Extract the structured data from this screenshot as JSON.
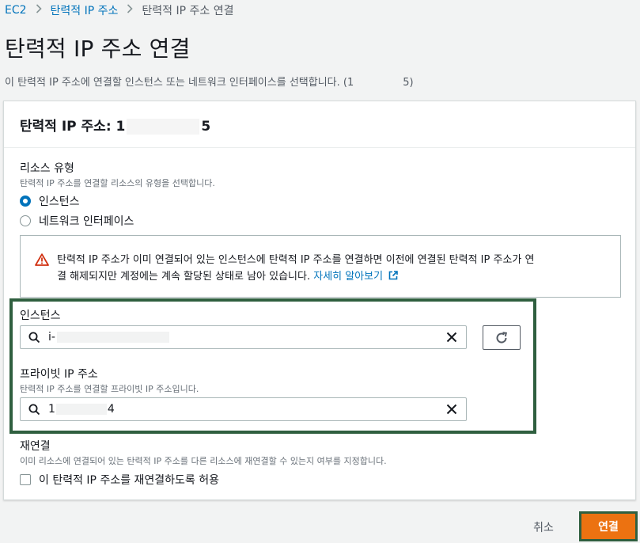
{
  "breadcrumb": {
    "items": [
      "EC2",
      "탄력적 IP 주소",
      "탄력적 IP 주소 연결"
    ]
  },
  "page": {
    "title": "탄력적 IP 주소 연결",
    "description_prefix": "이 탄력적 IP 주소에 연결할 인스턴스 또는 네트워크 인터페이스를 선택합니다. (1",
    "description_suffix": "5)"
  },
  "card": {
    "header_prefix": "탄력적 IP 주소: 1",
    "header_suffix": "5"
  },
  "resource_type": {
    "label": "리소스 유형",
    "hint": "탄력적 IP 주소를 연결할 리소스의 유형을 선택합니다.",
    "options": [
      "인스턴스",
      "네트워크 인터페이스"
    ],
    "selected": "인스턴스"
  },
  "warning": {
    "text_line1": "탄력적 IP 주소가 이미 연결되어 있는 인스턴스에 탄력적 IP 주소를 연결하면 이전에 연결된 탄력적 IP 주소가 연",
    "text_line2": "결 해제되지만 계정에는 계속 할당된 상태로 남아 있습니다. ",
    "link": "자세히 알아보기"
  },
  "instance": {
    "label": "인스턴스",
    "value_prefix": "i-"
  },
  "private_ip": {
    "label": "프라이빗 IP 주소",
    "hint": "탄력적 IP 주소를 연결할 프라이빗 IP 주소입니다.",
    "value_prefix": "1",
    "value_suffix": "4"
  },
  "reassociate": {
    "label": "재연결",
    "hint": "이미 리소스에 연결되어 있는 탄력적 IP 주소를 다른 리소스에 재연결할 수 있는지 여부를 지정합니다.",
    "checkbox_label": "이 탄력적 IP 주소를 재연결하도록 허용"
  },
  "actions": {
    "cancel": "취소",
    "connect": "연결"
  },
  "colors": {
    "link": "#0073bb",
    "primary": "#ec7211",
    "warning": "#d13212",
    "highlight": "#2f5f3f"
  }
}
